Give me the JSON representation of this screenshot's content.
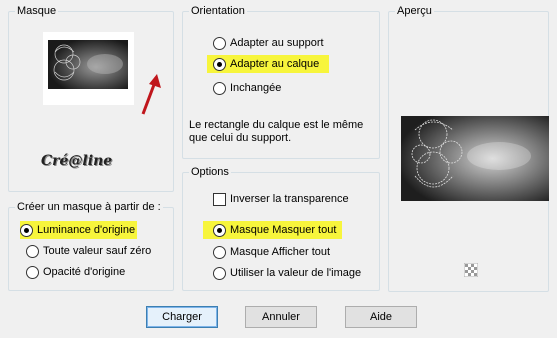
{
  "masque": {
    "title": "Masque",
    "watermark": "Cré@line"
  },
  "creer": {
    "title": "Créer un masque à partir de :",
    "options": [
      {
        "label": "Luminance d'origine",
        "checked": true
      },
      {
        "label": "Toute valeur sauf zéro",
        "checked": false
      },
      {
        "label": "Opacité d'origine",
        "checked": false
      }
    ]
  },
  "orientation": {
    "title": "Orientation",
    "options": [
      {
        "label": "Adapter au support",
        "checked": false
      },
      {
        "label": "Adapter au calque",
        "checked": true
      },
      {
        "label": "Inchangée",
        "checked": false
      }
    ],
    "note": "Le rectangle du calque est le même que celui du support."
  },
  "options": {
    "title": "Options",
    "invert_label": "Inverser la transparence",
    "invert_checked": false,
    "items": [
      {
        "label": "Masque Masquer tout",
        "checked": true
      },
      {
        "label": "Masque Afficher tout",
        "checked": false
      },
      {
        "label": "Utiliser la valeur de l'image",
        "checked": false
      }
    ]
  },
  "apercu": {
    "title": "Aperçu"
  },
  "buttons": {
    "charger": "Charger",
    "annuler": "Annuler",
    "aide": "Aide"
  },
  "colors": {
    "highlight": "#f7f53c",
    "arrow": "#c0161c"
  }
}
